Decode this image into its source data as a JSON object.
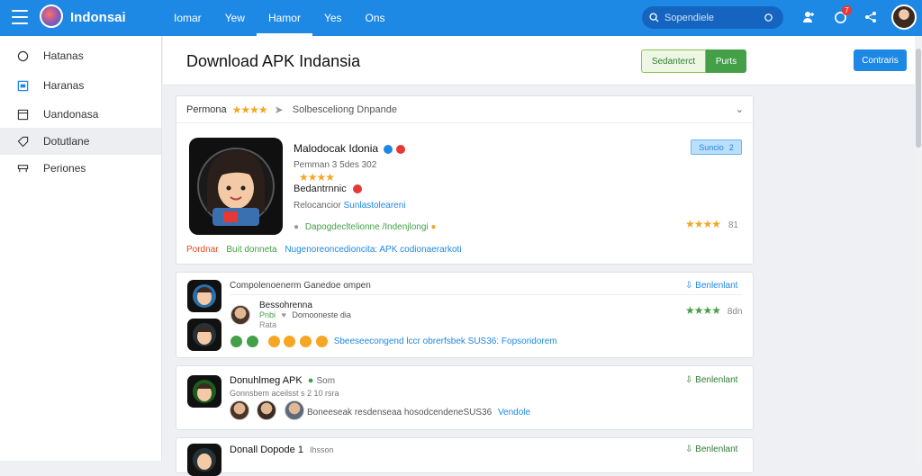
{
  "app": {
    "brand": "Indonsai"
  },
  "nav": {
    "items": [
      "Iomar",
      "Yew",
      "Hamor",
      "Yes",
      "Ons"
    ]
  },
  "search": {
    "placeholder": "Sopendiele"
  },
  "notifications": {
    "count": "7"
  },
  "sidebar": {
    "items": [
      {
        "label": "Hatanas",
        "icon": "circle-icon"
      },
      {
        "label": "Haranas",
        "icon": "calendar-icon"
      },
      {
        "label": "Uandonasa",
        "icon": "folder-icon"
      },
      {
        "label": "Dotutlane",
        "icon": "tag-icon"
      },
      {
        "label": "Periones",
        "icon": "grid-icon"
      }
    ]
  },
  "header": {
    "title": "Download APK Indansia",
    "btn_outline": "Sedanterct",
    "btn_green": "Purts",
    "btn_blue": "Contraris"
  },
  "featured": {
    "section_label": "Permona",
    "rating_stars": 4,
    "section_desc": "Solbesceliong Dnpande",
    "app_name": "Malodocak Idonia",
    "meta": "Pemman 3 5des 302",
    "developer": "Bedantrnnic",
    "category_prefix": "Relocancior",
    "category_link": "Sunlastoleareni",
    "description": "Dapogdecltelionne /Indenjlongi",
    "footer_orange": "Pordnar",
    "footer_green": "Buit donneta",
    "footer_link": "Nugenoreoncedioncita: APK codionaerarkoti",
    "chip": "Suncio",
    "chip_count": "2",
    "side_rating": "81",
    "side_stars": 4
  },
  "list": [
    {
      "header": "Compolenoenerm Ganedoe ompen",
      "download": "Benlenlant",
      "title": "Bessohrenna",
      "sub_green": "Pnbi",
      "sub_text": "Domooneste dia",
      "sub_small": "Rata",
      "icons_line": "Sbeeseecongend lccr obrerfsbek SUS36: Fopsoridorem",
      "stars": 4,
      "rating": "8dn"
    },
    {
      "title": "Donuhlmeg APK",
      "badge": "Som",
      "meta": "Gonnsbem aceilsst s 2 10 rsra",
      "line": "Boneeseak resdenseaa hosodcendeneSUS36",
      "line_link": "Vendole",
      "download": "Benlenlant"
    },
    {
      "title": "Donall Dopode 1",
      "badge": "Ihsson",
      "download": "Benlenlant"
    }
  ],
  "colors": {
    "topbar": "#1e88e5",
    "accent_green": "#43a047",
    "star": "#f5a623"
  }
}
